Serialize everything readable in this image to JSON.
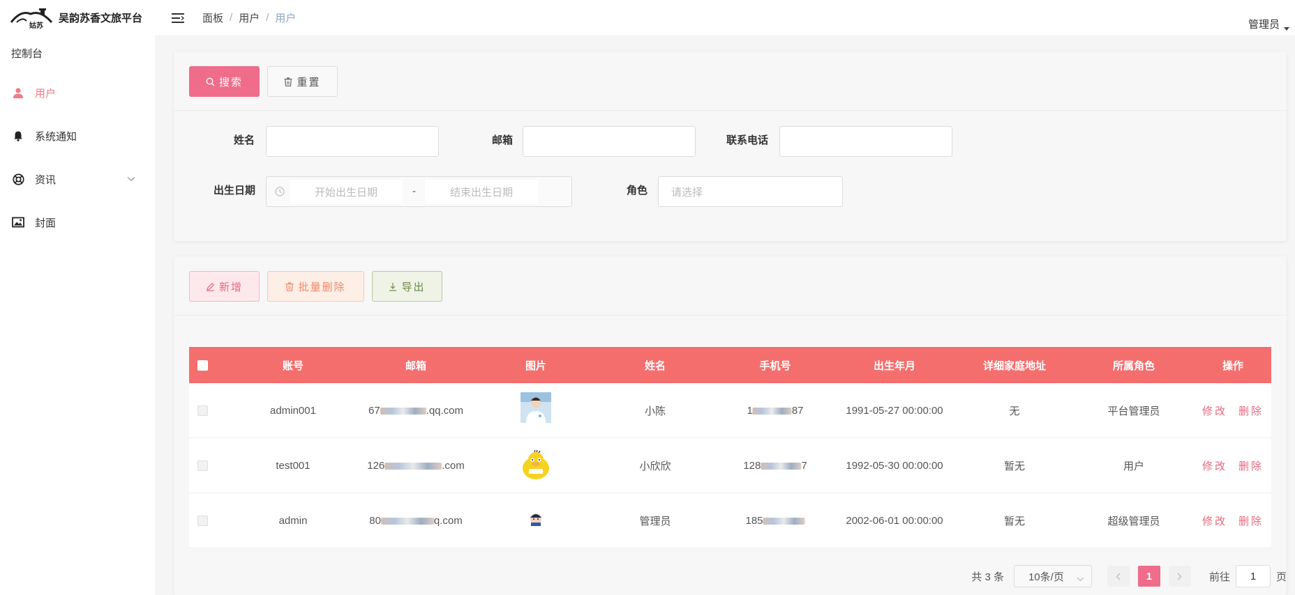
{
  "app": {
    "logo_text": "吴韵苏香文旅平台",
    "logo_small_text": "姑苏"
  },
  "sidebar": {
    "items": [
      {
        "label": "控制台",
        "icon": "none"
      },
      {
        "label": "用户",
        "icon": "user-icon",
        "active": true
      },
      {
        "label": "系统通知",
        "icon": "bell-icon"
      },
      {
        "label": "资讯",
        "icon": "lifebuoy-icon",
        "expandable": true
      },
      {
        "label": "封面",
        "icon": "picture-icon"
      }
    ]
  },
  "header": {
    "breadcrumb": [
      "面板",
      "用户",
      "用户"
    ],
    "user_label": "管理员"
  },
  "search_panel": {
    "search_label": "搜索",
    "reset_label": "重置",
    "fields": {
      "name_label": "姓名",
      "email_label": "邮箱",
      "phone_label": "联系电话",
      "birth_label": "出生日期",
      "birth_start_placeholder": "开始出生日期",
      "birth_sep": "-",
      "birth_end_placeholder": "结束出生日期",
      "role_label": "角色",
      "role_placeholder": "请选择"
    }
  },
  "toolbar": {
    "add_label": "新增",
    "batch_delete_label": "批量删除",
    "export_label": "导出"
  },
  "table": {
    "columns": [
      "账号",
      "邮箱",
      "图片",
      "姓名",
      "手机号",
      "出生年月",
      "详细家庭地址",
      "所属角色",
      "操作"
    ],
    "rows": [
      {
        "account": "admin001",
        "email_prefix": "67",
        "email_suffix": ".qq.com",
        "name": "小陈",
        "phone_prefix": "1",
        "phone_suffix": "87",
        "birth": "1991-05-27 00:00:00",
        "address": "无",
        "role": "平台管理员"
      },
      {
        "account": "test001",
        "email_prefix": "126",
        "email_suffix": ".com",
        "name": "小欣欣",
        "phone_prefix": "128",
        "phone_suffix": "7",
        "birth": "1992-05-30 00:00:00",
        "address": "暂无",
        "role": "用户"
      },
      {
        "account": "admin",
        "email_prefix": "80",
        "email_suffix": "q.com",
        "name": "管理员",
        "phone_prefix": "185",
        "phone_suffix": "",
        "birth": "2002-06-01 00:00:00",
        "address": "暂无",
        "role": "超级管理员"
      }
    ],
    "edit_label": "修改",
    "delete_label": "删除"
  },
  "pagination": {
    "total": "共 3 条",
    "page_size": "10条/页",
    "current_page": "1",
    "goto_prefix": "前往",
    "goto_value": "1",
    "goto_suffix": "页"
  },
  "colors": {
    "accent": "#ef6c8a",
    "table_header": "#f46e6e",
    "active_menu": "#f07c86"
  }
}
